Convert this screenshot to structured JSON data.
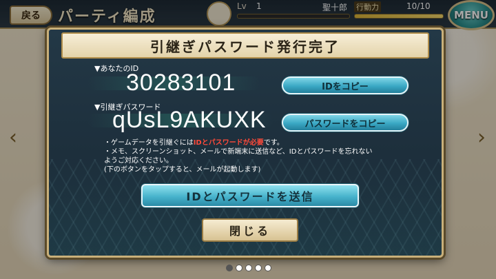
{
  "header": {
    "back_label": "戻る",
    "screen_title": "パーティ編成",
    "level_label": "Lv",
    "level_value": "1",
    "player_name": "聖十郎",
    "stamina_label": "行動力",
    "stamina_value": "10/10",
    "stamina_fraction": 1.0,
    "menu_label": "MENU"
  },
  "modal": {
    "title": "引継ぎパスワード発行完了",
    "id_label": "▼あなたのID",
    "id_value": "30283101",
    "copy_id_label": "IDをコピー",
    "password_label": "▼引継ぎパスワード",
    "password_value": "qUsL9AKUXK",
    "copy_password_label": "パスワードをコピー",
    "notes": {
      "line1_prefix": "・ゲームデータを引継ぐには",
      "line1_highlight": "IDとパスワードが必要",
      "line1_suffix": "です。",
      "line2": "・メモ、スクリーンショット、メールで新端末に送信など、IDとパスワードを忘れない",
      "line3": "ようご対応ください。",
      "line4": "(下のボタンをタップすると、メールが起動します)"
    },
    "send_label": "IDとパスワードを送信",
    "close_label": "閉じる"
  },
  "pager": {
    "count": 5,
    "active_index": 0
  },
  "colors": {
    "modal_bg": "#1d2f3c",
    "accent_button": "#3aa8c4",
    "highlight_text": "#ff4a3a",
    "gold_border": "#c9b07a"
  }
}
